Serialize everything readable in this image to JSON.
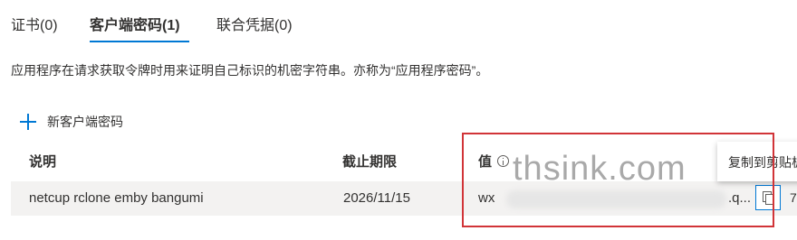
{
  "tabs": [
    {
      "label": "证书(0)"
    },
    {
      "label": "客户端密码(1)"
    },
    {
      "label": "联合凭据(0)"
    }
  ],
  "description": "应用程序在请求获取令牌时用来证明自己标识的机密字符串。亦称为“应用程序密码”。",
  "new_button_label": "新客户端密码",
  "table": {
    "headers": [
      "说明",
      "截止期限",
      "值"
    ],
    "rows": [
      {
        "description": "netcup rclone emby bangumi",
        "expires": "2026/11/15",
        "value_start": "wx",
        "value_end": ".q..."
      }
    ]
  },
  "tooltip": "复制到剪贴板",
  "copy_icon": "copy-icon",
  "edge_text": "7",
  "watermark": "thsink.com",
  "colors": {
    "accent": "#0078d4",
    "highlight": "#d13438",
    "row_bg": "#f3f2f1"
  }
}
